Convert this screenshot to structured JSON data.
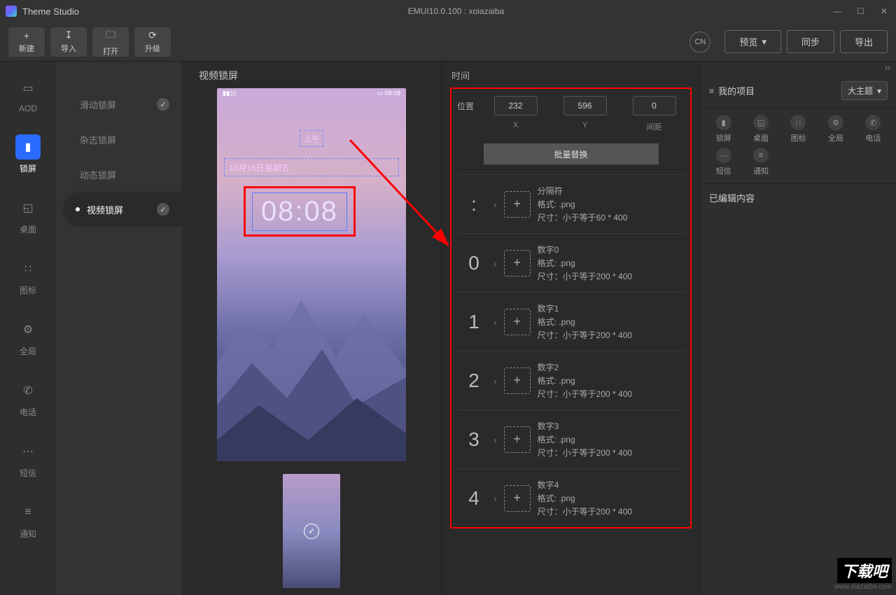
{
  "titlebar": {
    "app": "Theme Studio",
    "center": "EMUI10.0.100 : xoiazaiba"
  },
  "toolbar": {
    "new": "新建",
    "import": "导入",
    "open": "打开",
    "upgrade": "升级",
    "cn": "CN",
    "preview": "预览",
    "sync": "同步",
    "export": "导出"
  },
  "leftnav": [
    {
      "label": "AOD"
    },
    {
      "label": "锁屏"
    },
    {
      "label": "桌面"
    },
    {
      "label": "图标"
    },
    {
      "label": "全局"
    },
    {
      "label": "电话"
    },
    {
      "label": "短信"
    },
    {
      "label": "通知"
    }
  ],
  "sublist": [
    {
      "label": "滑动锁屏",
      "checked": true
    },
    {
      "label": "杂志锁屏"
    },
    {
      "label": "动态锁屏"
    },
    {
      "label": "视频锁屏",
      "active": true,
      "checked": true
    }
  ],
  "preview": {
    "title": "视频锁屏",
    "status_time": "08:08",
    "ampm": "上午",
    "date": "10月18日星期五",
    "clock": "08:08"
  },
  "inspector": {
    "section": "时间",
    "pos_label": "位置",
    "pos": {
      "x": "232",
      "y": "596",
      "gap": "0"
    },
    "axis": {
      "x": "X",
      "y": "Y",
      "gap": "间距"
    },
    "batch": "批量替换",
    "assets": [
      {
        "glyph": ":",
        "name": "分隔符",
        "format": "格式: .png",
        "size": "尺寸：小于等于60 * 400"
      },
      {
        "glyph": "0",
        "name": "数字0",
        "format": "格式: .png",
        "size": "尺寸：小于等于200 * 400"
      },
      {
        "glyph": "1",
        "name": "数字1",
        "format": "格式: .png",
        "size": "尺寸：小于等于200 * 400"
      },
      {
        "glyph": "2",
        "name": "数字2",
        "format": "格式: .png",
        "size": "尺寸：小于等于200 * 400"
      },
      {
        "glyph": "3",
        "name": "数字3",
        "format": "格式: .png",
        "size": "尺寸：小于等于200 * 400"
      },
      {
        "glyph": "4",
        "name": "数字4",
        "format": "格式: .png",
        "size": "尺寸：小于等于200 * 400"
      }
    ]
  },
  "rightpanel": {
    "project": "我的项目",
    "select": "大主题",
    "grid": [
      "锁屏",
      "桌面",
      "图标",
      "全局",
      "电话",
      "短信",
      "通知"
    ],
    "edited": "已编辑内容"
  },
  "watermark": {
    "site": "www.xiazaiba.com",
    "brand": "下载吧"
  }
}
